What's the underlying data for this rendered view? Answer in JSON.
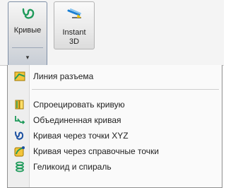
{
  "ribbon": {
    "curves_button": {
      "label": "Кривые",
      "icon": "curve-icon",
      "dropdown": "dropdown-arrow-icon"
    },
    "instant3d_button": {
      "label": "Instant 3D",
      "icon": "instant3d-icon"
    }
  },
  "menu": {
    "items": [
      {
        "label": "Линия разъема",
        "icon": "split-line-icon"
      },
      {
        "label": "Спроецировать кривую",
        "icon": "projected-curve-icon"
      },
      {
        "label": "Объединенная кривая",
        "icon": "composite-curve-icon"
      },
      {
        "label": "Кривая через точки XYZ",
        "icon": "curve-through-xyz-icon"
      },
      {
        "label": "Кривая через справочные точки",
        "icon": "curve-through-reference-points-icon"
      },
      {
        "label": "Геликоид и спираль",
        "icon": "helix-spiral-icon"
      }
    ]
  },
  "colors": {
    "icon_green": "#1e9a5a",
    "icon_yellow": "#f0b300",
    "menu_gutter": "#eeeeee"
  }
}
